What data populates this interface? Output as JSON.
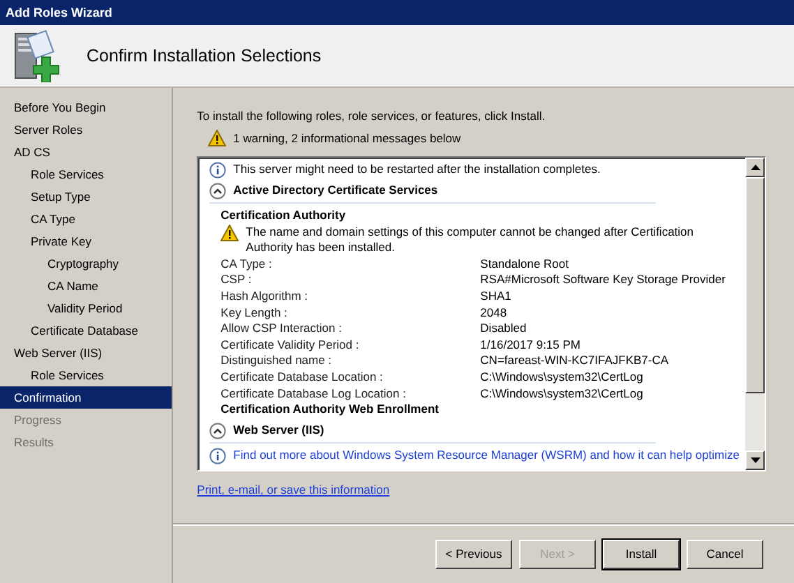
{
  "window": {
    "title": "Add Roles Wizard"
  },
  "header": {
    "title": "Confirm Installation Selections"
  },
  "sidebar": {
    "items": [
      {
        "label": "Before You Begin",
        "selected": false,
        "disabled": false
      },
      {
        "label": "Server Roles",
        "selected": false,
        "disabled": false
      },
      {
        "label": "AD CS",
        "selected": false,
        "disabled": false,
        "children": [
          {
            "label": "Role Services",
            "selected": false,
            "disabled": false
          },
          {
            "label": "Setup Type",
            "selected": false,
            "disabled": false
          },
          {
            "label": "CA Type",
            "selected": false,
            "disabled": false
          },
          {
            "label": "Private Key",
            "selected": false,
            "disabled": false,
            "children": [
              {
                "label": "Cryptography",
                "selected": false,
                "disabled": false
              },
              {
                "label": "CA Name",
                "selected": false,
                "disabled": false
              },
              {
                "label": "Validity Period",
                "selected": false,
                "disabled": false
              }
            ]
          },
          {
            "label": "Certificate Database",
            "selected": false,
            "disabled": false
          }
        ]
      },
      {
        "label": "Web Server (IIS)",
        "selected": false,
        "disabled": false,
        "children": [
          {
            "label": "Role Services",
            "selected": false,
            "disabled": false
          }
        ]
      },
      {
        "label": "Confirmation",
        "selected": true,
        "disabled": false
      },
      {
        "label": "Progress",
        "selected": false,
        "disabled": true
      },
      {
        "label": "Results",
        "selected": false,
        "disabled": true
      }
    ]
  },
  "intro": "To install the following roles, role services, or features, click Install.",
  "summary": "1 warning, 2 informational messages below",
  "details": [
    {
      "kind": "info",
      "text": "This server might need to be restarted after the installation completes."
    },
    {
      "kind": "section",
      "text": "Active Directory Certificate Services",
      "expanded": true
    },
    {
      "kind": "subsection",
      "text": "Certification Authority"
    },
    {
      "kind": "warning",
      "text": "The name and domain settings of this computer cannot be changed after Certification Authority has been installed."
    },
    {
      "kind": "property",
      "label": "CA Type :",
      "value": "Standalone Root"
    },
    {
      "kind": "property",
      "label": "CSP :",
      "value": "RSA#Microsoft Software Key Storage Provider"
    },
    {
      "kind": "property",
      "label": "Hash Algorithm :",
      "value": "SHA1"
    },
    {
      "kind": "property",
      "label": "Key Length :",
      "value": "2048"
    },
    {
      "kind": "property",
      "label": "Allow CSP Interaction :",
      "value": "Disabled"
    },
    {
      "kind": "property",
      "label": "Certificate Validity Period :",
      "value": "1/16/2017 9:15 PM"
    },
    {
      "kind": "property",
      "label": "Distinguished name :",
      "value": "CN=fareast-WIN-KC7IFAJFKB7-CA"
    },
    {
      "kind": "property",
      "label": "Certificate Database Location :",
      "value": "C:\\Windows\\system32\\CertLog"
    },
    {
      "kind": "property",
      "label": "Certificate Database Log Location :",
      "value": "C:\\Windows\\system32\\CertLog"
    },
    {
      "kind": "subsection",
      "text": "Certification Authority Web Enrollment"
    },
    {
      "kind": "section",
      "text": "Web Server (IIS)",
      "expanded": true
    },
    {
      "kind": "info_link",
      "text": "Find out more about Windows System Resource Manager (WSRM) and how it can help optimize"
    }
  ],
  "footer_link": "Print, e-mail, or save this information",
  "buttons": [
    {
      "label": "< Previous",
      "disabled": false,
      "focused": false
    },
    {
      "label": "Next >",
      "disabled": true,
      "focused": false
    },
    {
      "label": "Install",
      "disabled": false,
      "focused": true
    },
    {
      "label": "Cancel",
      "disabled": false,
      "focused": false
    }
  ]
}
